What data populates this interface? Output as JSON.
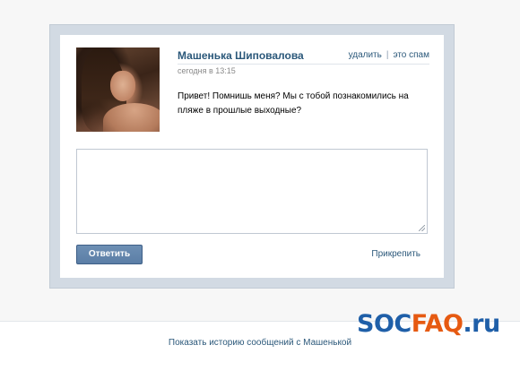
{
  "message": {
    "sender_name": "Машенька Шиповалова",
    "timestamp": "сегодня в 13:15",
    "text": "Привет! Помнишь меня? Мы с тобой познакомились на пляже в прошлые выходные?",
    "actions": {
      "delete_label": "удалить",
      "separator": "|",
      "spam_label": "это спам"
    }
  },
  "reply": {
    "textarea_value": "",
    "button_label": "Ответить",
    "attach_label": "Прикрепить"
  },
  "footer": {
    "history_link": "Показать историю сообщений с Машенькой"
  },
  "watermark": {
    "part1": "SOC",
    "part2": "FAQ",
    "part3": ".ru"
  },
  "colors": {
    "link": "#2b587a",
    "button": "#5b7ea6",
    "frame": "#d2dae3",
    "watermark_blue": "#1f5fa8",
    "watermark_orange": "#e65a12"
  }
}
